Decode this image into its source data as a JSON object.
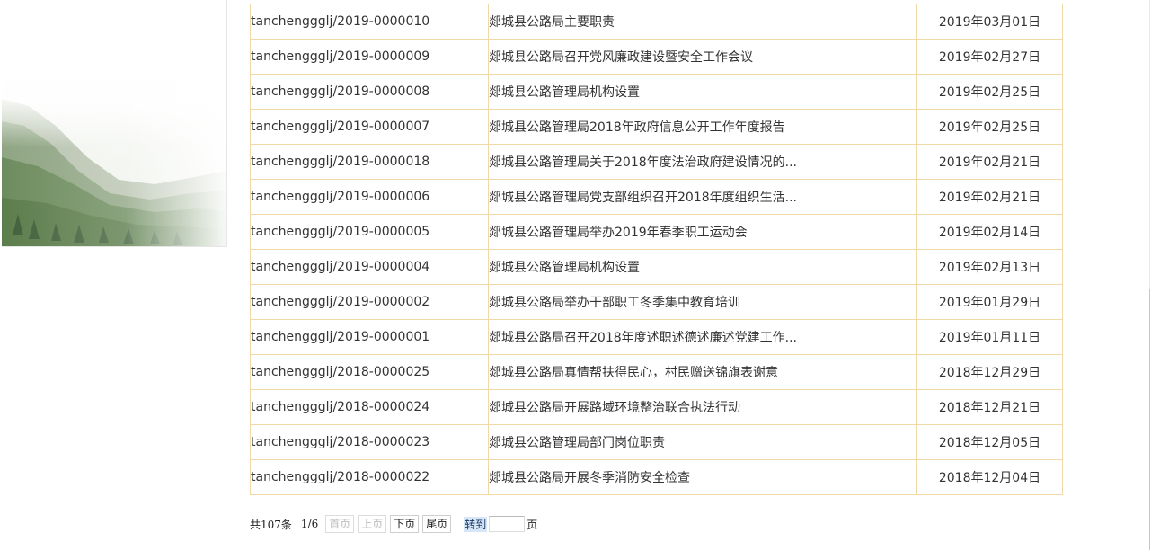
{
  "documents": [
    {
      "id": "tanchenggglj/2019-0000010",
      "title": "郯城县公路局主要职责",
      "date": "2019年03月01日"
    },
    {
      "id": "tanchenggglj/2019-0000009",
      "title": "郯城县公路局召开党风廉政建设暨安全工作会议",
      "date": "2019年02月27日"
    },
    {
      "id": "tanchenggglj/2019-0000008",
      "title": "郯城县公路管理局机构设置",
      "date": "2019年02月25日"
    },
    {
      "id": "tanchenggglj/2019-0000007",
      "title": "郯城县公路管理局2018年政府信息公开工作年度报告",
      "date": "2019年02月25日"
    },
    {
      "id": "tanchenggglj/2019-0000018",
      "title": "郯城县公路管理局关于2018年度法治政府建设情况的...",
      "date": "2019年02月21日"
    },
    {
      "id": "tanchenggglj/2019-0000006",
      "title": "郯城县公路管理局党支部组织召开2018年度组织生活...",
      "date": "2019年02月21日"
    },
    {
      "id": "tanchenggglj/2019-0000005",
      "title": "郯城县公路管理局举办2019年春季职工运动会",
      "date": "2019年02月14日"
    },
    {
      "id": "tanchenggglj/2019-0000004",
      "title": "郯城县公路管理局机构设置",
      "date": "2019年02月13日"
    },
    {
      "id": "tanchenggglj/2019-0000002",
      "title": "郯城县公路局举办干部职工冬季集中教育培训",
      "date": "2019年01月29日"
    },
    {
      "id": "tanchenggglj/2019-0000001",
      "title": "郯城县公路局召开2018年度述职述德述廉述党建工作...",
      "date": "2019年01月11日"
    },
    {
      "id": "tanchenggglj/2018-0000025",
      "title": "郯城县公路局真情帮扶得民心，村民赠送锦旗表谢意",
      "date": "2018年12月29日"
    },
    {
      "id": "tanchenggglj/2018-0000024",
      "title": "郯城县公路局开展路域环境整治联合执法行动",
      "date": "2018年12月21日"
    },
    {
      "id": "tanchenggglj/2018-0000023",
      "title": "郯城县公路管理局部门岗位职责",
      "date": "2018年12月05日"
    },
    {
      "id": "tanchenggglj/2018-0000022",
      "title": "郯城县公路局开展冬季消防安全检查",
      "date": "2018年12月04日"
    }
  ],
  "pagination": {
    "total": "共107条",
    "position": "1/6",
    "first": "首页",
    "prev": "上页",
    "next": "下页",
    "last": "尾页",
    "goto": "转到",
    "page_input_value": "",
    "page_suffix": "页"
  },
  "colors": {
    "table_border": "#f0d9a6",
    "text": "#333333",
    "goto_highlight": "#d6e6f7"
  },
  "icons": {
    "banner": "mountain-landscape-image"
  }
}
